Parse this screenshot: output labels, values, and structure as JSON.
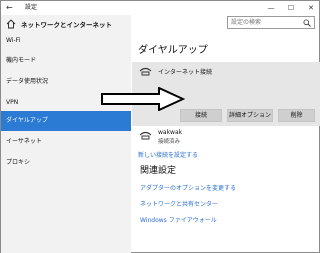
{
  "window": {
    "title": "設定",
    "minimize": "—",
    "maximize": "☐",
    "close": "✕"
  },
  "header": {
    "home_label": "ネットワークとインターネット"
  },
  "search": {
    "placeholder": "設定の検索"
  },
  "sidebar": {
    "items": [
      {
        "label": "Wi-Fi"
      },
      {
        "label": "機内モード"
      },
      {
        "label": "データ使用状況"
      },
      {
        "label": "VPN"
      },
      {
        "label": "ダイヤルアップ",
        "active": true
      },
      {
        "label": "イーサネット"
      },
      {
        "label": "プロキシ"
      }
    ]
  },
  "main": {
    "title": "ダイヤルアップ",
    "connections": [
      {
        "name": "インターネット接続",
        "status": ""
      },
      {
        "name": "wakwak",
        "status": "接続済み"
      }
    ],
    "buttons": {
      "connect": "接続",
      "advanced": "詳細オプション",
      "delete": "削除"
    },
    "new_connection_link": "新しい接続を設定する",
    "related_title": "関連設定",
    "related_links": [
      "アダプターのオプションを変更する",
      "ネットワークと共有センター",
      "Windows ファイアウォール"
    ]
  }
}
